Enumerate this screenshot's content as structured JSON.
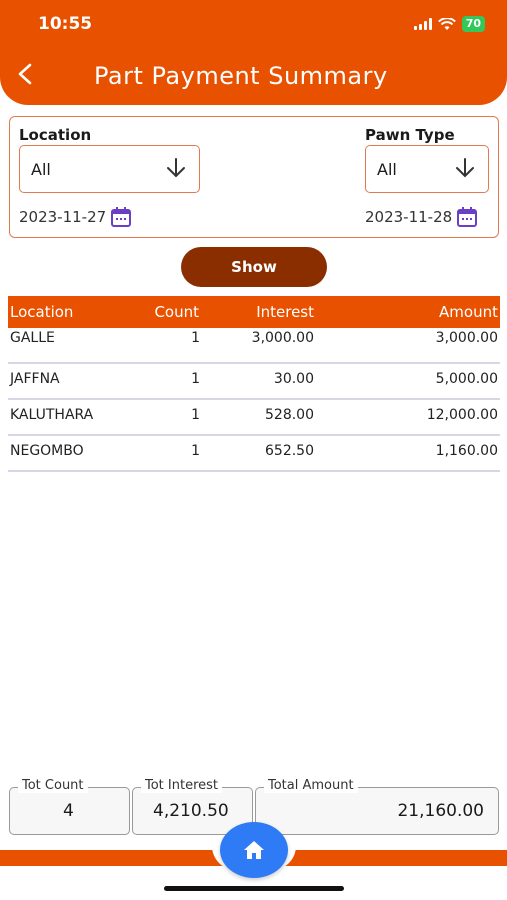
{
  "status_bar": {
    "time": "10:55",
    "battery": "70"
  },
  "header": {
    "title": "Part Payment Summary"
  },
  "filters": {
    "location_label": "Location",
    "location_value": "All",
    "pawn_type_label": "Pawn Type",
    "pawn_type_value": "All",
    "from_date": "2023-11-27",
    "to_date": "2023-11-28"
  },
  "show_button": "Show",
  "table": {
    "headers": [
      "Location",
      "Count",
      "Interest",
      "Amount"
    ],
    "rows": [
      [
        "GALLE",
        "1",
        "3,000.00",
        "3,000.00"
      ],
      [
        "JAFFNA",
        "1",
        "30.00",
        "5,000.00"
      ],
      [
        "KALUTHARA",
        "1",
        "528.00",
        "12,000.00"
      ],
      [
        "NEGOMBO",
        "1",
        "652.50",
        "1,160.00"
      ]
    ]
  },
  "totals": {
    "count_label": "Tot Count",
    "count_value": "4",
    "interest_label": "Tot Interest",
    "interest_value": "4,210.50",
    "amount_label": "Total Amount",
    "amount_value": "21,160.00"
  },
  "colors": {
    "primary": "#E85100",
    "button": "#8A2E00",
    "home": "#2F7BF5",
    "calendar": "#6A3FC6"
  }
}
